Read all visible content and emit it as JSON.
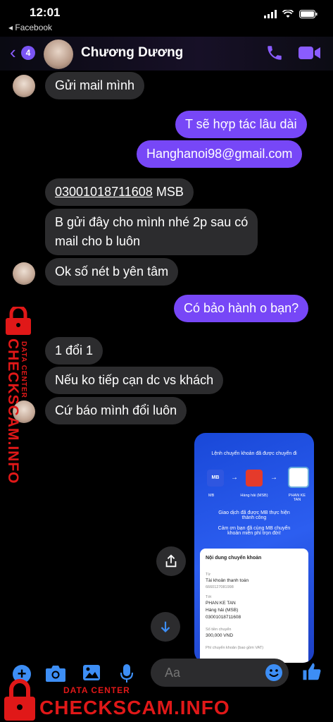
{
  "status_bar": {
    "time": "12:01",
    "back_app": "◂ Facebook"
  },
  "header": {
    "unread_count": "4",
    "contact_name": "Chương Dương"
  },
  "messages": [
    {
      "text": "Gửi mail mình",
      "from": "contact"
    },
    {
      "text": "T sẽ hợp tác lâu dài",
      "from": "me"
    },
    {
      "text": "Hanghanoi98@gmail.com",
      "from": "me"
    },
    {
      "account": "03001018711608",
      "bank": " MSB",
      "from": "contact"
    },
    {
      "line1": "B gửi đây cho mình nhé 2p sau có",
      "line2": "mail cho b luôn",
      "from": "contact"
    },
    {
      "text": "Ok số nét b yên tâm",
      "from": "contact"
    },
    {
      "text": "Có bảo hành o bạn?",
      "from": "me"
    },
    {
      "text": "1 đổi 1",
      "from": "contact"
    },
    {
      "text": "Nếu ko tiếp cạn dc vs khách",
      "from": "contact"
    },
    {
      "text": "Cứ báo mình đổi luôn",
      "from": "contact"
    }
  ],
  "transfer_card": {
    "title": "Lệnh chuyển khoản đã được chuyển đi",
    "from_label": "MB",
    "mid_label": "Hàng hải (MSB)",
    "to_label_1": "PHAN KE",
    "to_label_2": "TAN",
    "notice_1": "Giao dịch đã được MB thực hiện",
    "notice_2": "thành công",
    "thanks_1": "Cảm ơn bạn đã cùng MB chuyển",
    "thanks_2": "khoản miễn phí trọn đời!",
    "section_title": "Nội dung chuyển khoản",
    "from_field_label": "Từ",
    "from_account_type": "Tài khoản thanh toán",
    "from_account_number": "6660127081998",
    "to_field_label": "Tới",
    "to_name": "PHAN KE TAN",
    "to_bank": "Hàng hải (MSB)",
    "to_account_number": "03001018711608",
    "amount_label": "Số tiền chuyển",
    "amount": "300,000 VND",
    "fee_label": "Phí chuyển khoản (bao gồm VAT)"
  },
  "composer": {
    "placeholder": "Aa"
  },
  "watermark": {
    "vertical_big": "CHECKSCAM.INFO",
    "vertical_small": "DATA CENTER",
    "bottom_big": "CHECKSCAM.INFO",
    "bottom_small": "DATA CENTER"
  },
  "colors": {
    "accent": "#7b55f5",
    "bubble_out": "#7747f7",
    "bubble_in": "#2c2c2e",
    "watermark": "#e01818"
  },
  "icons": [
    "signal-icon",
    "wifi-icon",
    "battery-icon",
    "phone-icon",
    "video-icon",
    "share-icon",
    "scroll-down-icon",
    "plus-icon",
    "camera-icon",
    "gallery-icon",
    "mic-icon",
    "emoji-icon",
    "like-icon",
    "lock-icon"
  ]
}
